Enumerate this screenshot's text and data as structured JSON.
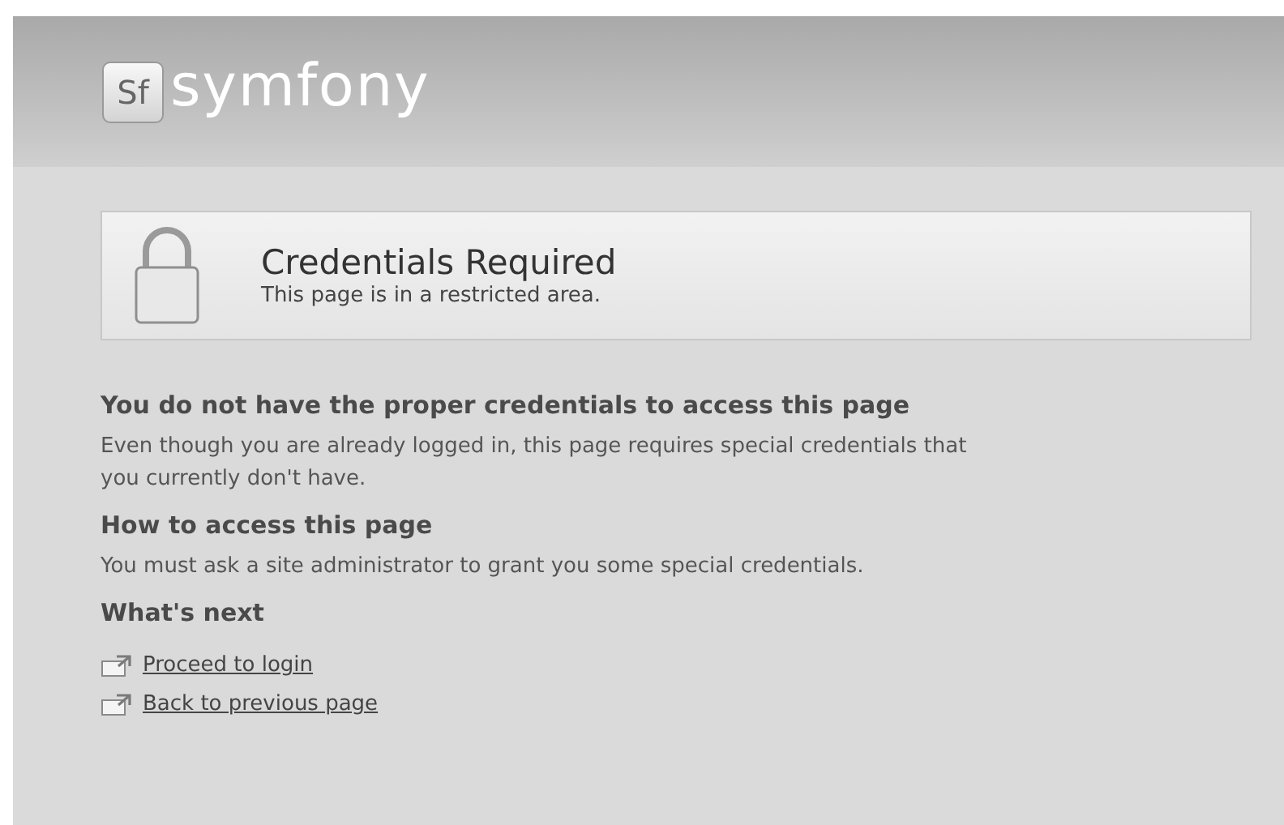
{
  "logo": {
    "badge": "Sf",
    "name": "symfony"
  },
  "notice": {
    "title": "Credentials Required",
    "subtitle": "This page is in a restricted area."
  },
  "sections": [
    {
      "heading": "You do not have the proper credentials to access this page",
      "text": "Even though you are already logged in, this page requires special credentials that you currently don't have."
    },
    {
      "heading": "How to access this page",
      "text": "You must ask a site administrator to grant you some special credentials."
    },
    {
      "heading": "What's next"
    }
  ],
  "links": [
    {
      "label": "Proceed to login"
    },
    {
      "label": "Back to previous page"
    }
  ]
}
